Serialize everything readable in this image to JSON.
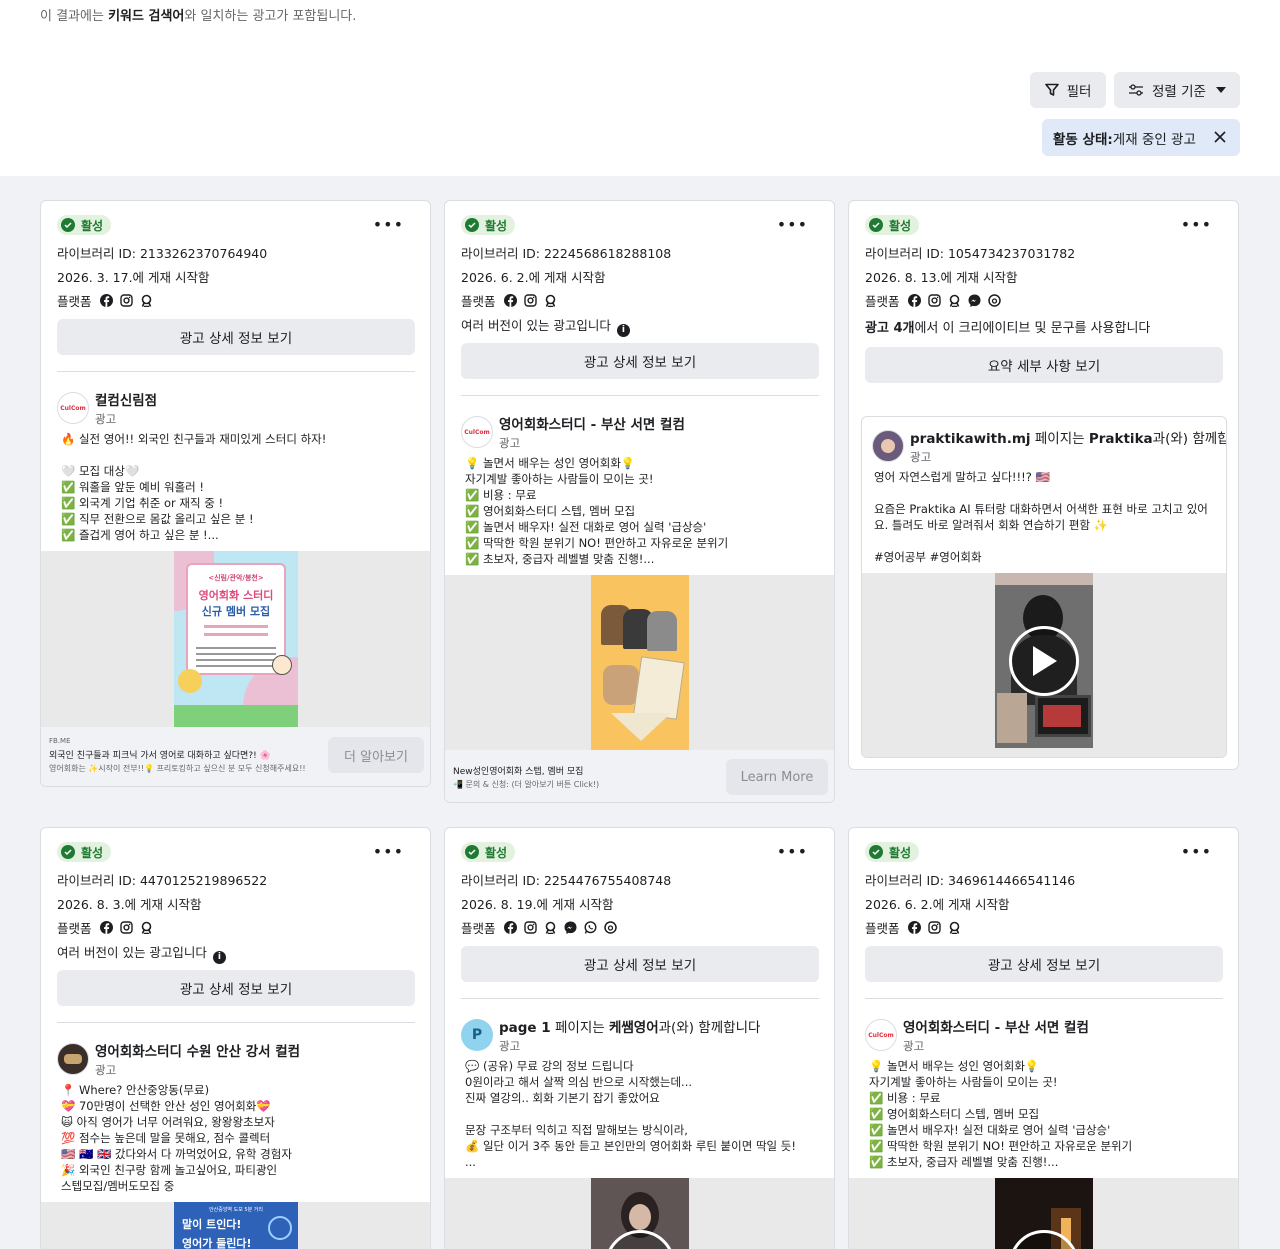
{
  "header": {
    "note_prefix": "이 결과에는 ",
    "note_bold": "키워드 검색어",
    "note_suffix": "와 일치하는 광고가 포함됩니다.",
    "filter_label": "필터",
    "sort_label": "정렬 기준",
    "chip_key": "활동 상태:",
    "chip_value": " 게재 중인 광고"
  },
  "cards": [
    {
      "status": "활성",
      "library_id": "라이브러리 ID: 2133262370764940",
      "started": "2026. 3. 17.에 게재 시작함",
      "platform_label": "플랫폼",
      "platforms": [
        "facebook-icon",
        "instagram-icon",
        "audience-network-icon"
      ],
      "detail_button": "광고 상세 정보 보기",
      "advertiser": "컬컴신림점",
      "sponsored": "광고",
      "avatar_text": "CulCom",
      "body": "🔥 실전 영어!! 외국인 친구들과 재미있게 스터디 하자!\n\n🤍 모집 대상🤍\n✅ 워홀을 앞둔 예비 워홀러 !\n✅ 외국계 기업 취준 or 재직 중 !\n✅ 직무 전환으로 몸값 올리고 싶은 분 !\n✅ 즐겁게 영어 하고 싶은 분 !...",
      "poster": {
        "tag": "<신림/관악/봉천>",
        "title1": "영어회화 스터디",
        "title2": "신규 멤버 모집"
      },
      "footer_domain": "FB.ME",
      "footer_title": "외국인 친구들과 피크닉 가서 영어로 대화하고 싶다면?! 🌸",
      "footer_desc": "영어회화는 ✨시작이 전부!!💡 프리토킹하고 싶으신 분 모두 신청해주세요!!",
      "cta": "더 알아보기"
    },
    {
      "status": "활성",
      "library_id": "라이브러리 ID: 2224568618288108",
      "started": "2026. 6. 2.에 게재 시작함",
      "platform_label": "플랫폼",
      "platforms": [
        "facebook-icon",
        "instagram-icon",
        "audience-network-icon"
      ],
      "versions_note": "여러 버전이 있는 광고입니다",
      "detail_button": "광고 상세 정보 보기",
      "advertiser": "영어회화스터디 - 부산 서면 컬컴",
      "sponsored": "광고",
      "avatar_text": "CulCom",
      "body": "💡 놀면서 배우는 성인 영어회화💡\n자기계발 좋아하는 사람들이 모이는 곳!\n✅ 비용 : 무료\n✅ 영어회화스터디 스텝, 멤버 모집\n✅ 놀면서 배우자! 실전 대화로 영어 실력 '급상승'\n✅ 딱딱한 학원 분위기 NO! 편안하고 자유로운 분위기\n✅ 초보자, 중급자 레벨별 맞춤 진행!...",
      "footer_title": "New성인영어회화 스텝, 멤버 모집",
      "footer_desc": "📲 문의 & 신청: (더 알아보기 버튼 Click!)",
      "cta": "Learn More"
    },
    {
      "status": "활성",
      "library_id": "라이브러리 ID: 1054734237031782",
      "started": "2026. 8. 13.에 게재 시작함",
      "platform_label": "플랫폼",
      "platforms": [
        "facebook-icon",
        "instagram-icon",
        "audience-network-icon",
        "messenger-icon",
        "threads-icon"
      ],
      "multi_creative_bold": "광고 4개",
      "multi_creative_rest": "에서 이 크리에이티브 및 문구를 사용합니다",
      "detail_button": "요약 세부 사항 보기",
      "advertiser_bold": "praktikawith.mj",
      "advertiser_mid": " 페이지는 ",
      "advertiser_bold2": "Praktika",
      "advertiser_end": "과(와) 함께합니다",
      "sponsored": "광고",
      "body": "영어 자연스럽게 말하고 싶다!!!? 🇺🇸\n\n요즘은 Praktika AI 튜터랑 대화하면서 어색한 표현 바로 고치고 있어요. 틀려도 바로 알려줘서 회화 연습하기 편함 ✨\n\n#영어공부 #영어회화"
    },
    {
      "status": "활성",
      "library_id": "라이브러리 ID: 4470125219896522",
      "started": "2026. 8. 3.에 게재 시작함",
      "platform_label": "플랫폼",
      "platforms": [
        "facebook-icon",
        "instagram-icon",
        "audience-network-icon"
      ],
      "versions_note": "여러 버전이 있는 광고입니다",
      "detail_button": "광고 상세 정보 보기",
      "advertiser": "영어회화스터디 수원 안산 강서 컬컴",
      "sponsored": "광고",
      "body": "📍 Where? 안산중앙동(무료)\n💝 70만명이 선택한 안산 성인 영어회화💝\n🙀 아직 영어가 너무 어려워요, 왕왕왕초보자\n💯 점수는 높은데 말을 못해요, 점수 콜렉터\n🇺🇸 🇦🇺 🇬🇧 갔다와서 다 까먹었어요, 유학 경험자\n🎉 외국인 친구랑 함께 놀고싶어요, 파티광인\n스텝모집/멤버도모집 중",
      "poster": {
        "tag": "안산중앙역 도보 5분 거리",
        "title1": "말이 트인다!",
        "title2": "영어가 들린다!"
      }
    },
    {
      "status": "활성",
      "library_id": "라이브러리 ID: 2254476755408748",
      "started": "2026. 8. 19.에 게재 시작함",
      "platform_label": "플랫폼",
      "platforms": [
        "facebook-icon",
        "instagram-icon",
        "audience-network-icon",
        "messenger-icon",
        "whatsapp-icon",
        "threads-icon"
      ],
      "detail_button": "광고 상세 정보 보기",
      "advertiser_bold": "page 1",
      "advertiser_mid": " 페이지는 ",
      "advertiser_bold2": "케쌤영어",
      "advertiser_end": "과(와) 함께합니다",
      "avatar_text": "P",
      "sponsored": "광고",
      "body": "💬 (공유) 무료 강의 정보 드립니다\n0원이라고 해서 살짝 의심 반으로 시작했는데...\n진짜 열강의.. 회화 기본기 잡기 좋았어요\n\n문장 구조부터 익히고 직접 말해보는 방식이라,\n💰 일단 이거 3주 동안 듣고 본인만의 영어회화 루틴 붙이면 딱일 듯!\n..."
    },
    {
      "status": "활성",
      "library_id": "라이브러리 ID: 3469614466541146",
      "started": "2026. 6. 2.에 게재 시작함",
      "platform_label": "플랫폼",
      "platforms": [
        "facebook-icon",
        "instagram-icon",
        "audience-network-icon"
      ],
      "detail_button": "광고 상세 정보 보기",
      "advertiser": "영어회화스터디 - 부산 서면 컬컴",
      "sponsored": "광고",
      "avatar_text": "CulCom",
      "body": "💡 놀면서 배우는 성인 영어회화💡\n자기계발 좋아하는 사람들이 모이는 곳!\n✅ 비용 : 무료\n✅ 영어회화스터디 스텝, 멤버 모집\n✅ 놀면서 배우자! 실전 대화로 영어 실력 '급상승'\n✅ 딱딱한 학원 분위기 NO! 편안하고 자유로운 분위기\n✅ 초보자, 중급자 레벨별 맞춤 진행!..."
    }
  ]
}
